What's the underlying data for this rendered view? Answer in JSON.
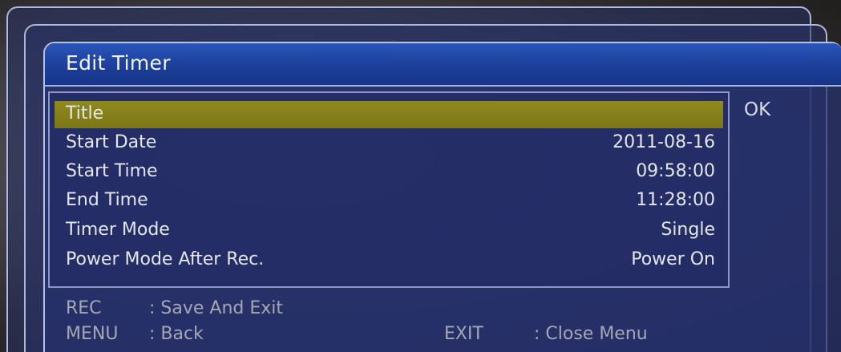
{
  "dialog": {
    "title": "Edit Timer",
    "ok_label": "OK"
  },
  "fields": [
    {
      "label": "Title",
      "value": "",
      "selected": true
    },
    {
      "label": "Start Date",
      "value": "2011-08-16",
      "selected": false
    },
    {
      "label": "Start Time",
      "value": "09:58:00",
      "selected": false
    },
    {
      "label": "End Time",
      "value": "11:28:00",
      "selected": false
    },
    {
      "label": "Timer Mode",
      "value": "Single",
      "selected": false
    },
    {
      "label": "Power Mode After Rec.",
      "value": "Power On",
      "selected": false
    }
  ],
  "footer": {
    "rec_key": "REC",
    "rec_action": ": Save And Exit",
    "menu_key": "MENU",
    "menu_action": ": Back",
    "exit_key": "EXIT",
    "exit_action": ": Close Menu"
  },
  "colors": {
    "title_bar": "#1c3f9a",
    "selection": "#8f8a1e",
    "panel": "#26306e"
  }
}
